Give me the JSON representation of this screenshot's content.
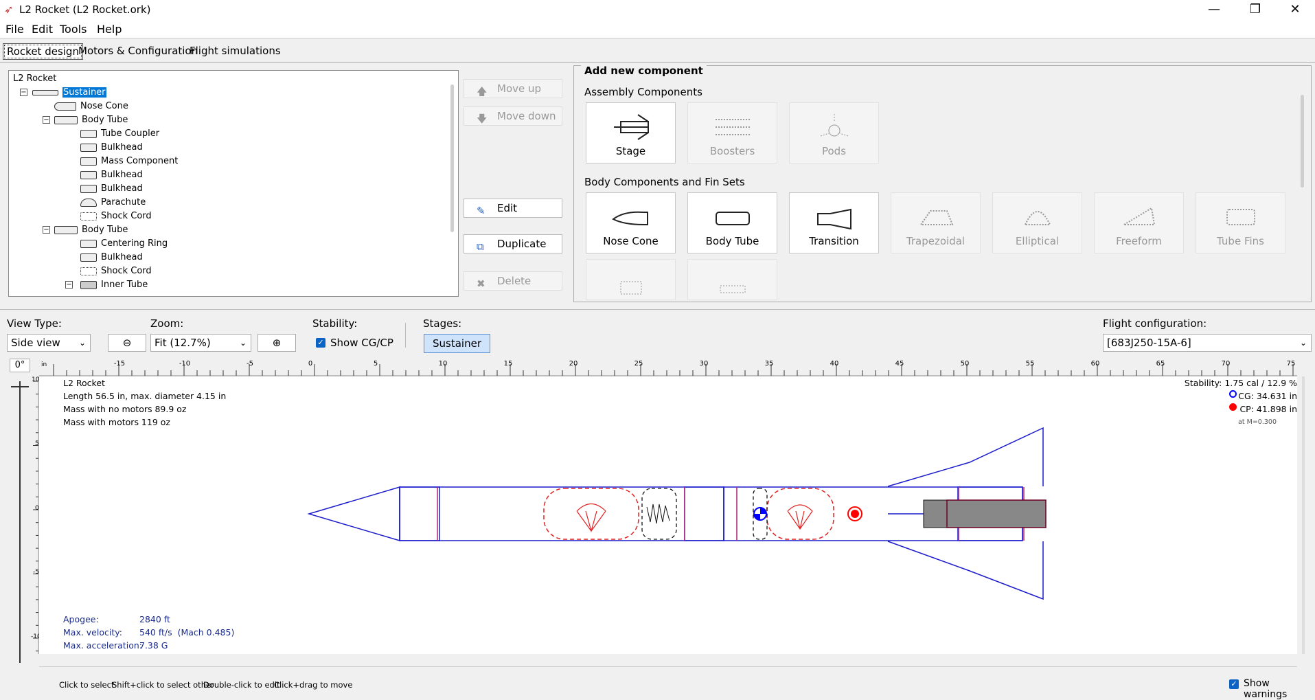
{
  "window": {
    "title": "L2 Rocket (L2 Rocket.ork)",
    "minimize": "—",
    "maximize": "❐",
    "close": "✕"
  },
  "menu": [
    "File",
    "Edit",
    "Tools",
    "Help"
  ],
  "tabs": [
    "Rocket design",
    "Motors & Configuration",
    "Flight simulations"
  ],
  "tree": {
    "root": "L2 Rocket",
    "items": [
      {
        "label": "Sustainer",
        "selected": true
      },
      {
        "label": "Nose Cone"
      },
      {
        "label": "Body Tube"
      },
      {
        "label": "Tube Coupler"
      },
      {
        "label": "Bulkhead"
      },
      {
        "label": "Mass Component"
      },
      {
        "label": "Bulkhead"
      },
      {
        "label": "Bulkhead"
      },
      {
        "label": "Parachute"
      },
      {
        "label": "Shock Cord"
      },
      {
        "label": "Body Tube"
      },
      {
        "label": "Centering Ring"
      },
      {
        "label": "Bulkhead"
      },
      {
        "label": "Shock Cord"
      },
      {
        "label": "Inner Tube"
      }
    ]
  },
  "side_buttons": {
    "move_up": "Move up",
    "move_down": "Move down",
    "edit": "Edit",
    "duplicate": "Duplicate",
    "delete": "Delete"
  },
  "add_panel": {
    "title": "Add new component",
    "assembly_heading": "Assembly Components",
    "assembly": [
      "Stage",
      "Boosters",
      "Pods"
    ],
    "body_heading": "Body Components and Fin Sets",
    "body": [
      "Nose Cone",
      "Body Tube",
      "Transition",
      "Trapezoidal",
      "Elliptical",
      "Freeform",
      "Tube Fins"
    ]
  },
  "view": {
    "view_type_label": "View Type:",
    "view_type": "Side view",
    "zoom_label": "Zoom:",
    "zoom": "Fit (12.7%)",
    "stability_label": "Stability:",
    "show_cgcp": "Show CG/CP",
    "show_cgcp_checked": true,
    "stages_label": "Stages:",
    "stage": "Sustainer",
    "flight_config_label": "Flight configuration:",
    "flight_config": "[683J250-15A-6]"
  },
  "ruler": {
    "unit": "in",
    "angle": "0°",
    "x_ticks": [
      "-15",
      "-10",
      "-5",
      "0",
      "5",
      "10",
      "15",
      "20",
      "25",
      "30",
      "35",
      "40",
      "45",
      "50",
      "55",
      "60",
      "65",
      "70",
      "75"
    ],
    "y_ticks": [
      "10",
      "5",
      "0",
      "-5",
      "-10"
    ]
  },
  "figure": {
    "name": "L2 Rocket",
    "length": "Length 56.5 in, max. diameter 4.15 in",
    "mass_no_motors": "Mass with no motors 89.9 oz",
    "mass_motors": "Mass with motors 119 oz",
    "stability": "Stability: 1.75 cal / 12.9 %",
    "cg": "CG: 34.631 in",
    "cp": "CP: 41.898 in",
    "mach": "at M=0.300",
    "apogee_label": "Apogee:",
    "apogee": "2840 ft",
    "vmax_label": "Max. velocity:",
    "vmax": "540 ft/s  (Mach 0.485)",
    "amax_label": "Max. acceleration:",
    "amax": "7.38 G"
  },
  "status": {
    "hints": [
      "Click to select",
      "Shift+click to select other",
      "Double-click to edit",
      "Click+drag to move"
    ],
    "show_warnings": "Show warnings",
    "show_warnings_checked": true
  },
  "colors": {
    "selection": "#0078d7",
    "outline": "#1c1ccd",
    "recovery": "#e02020",
    "motor": "#8a8a8a",
    "cp": "#ff0000",
    "cg": "#0000ff"
  }
}
